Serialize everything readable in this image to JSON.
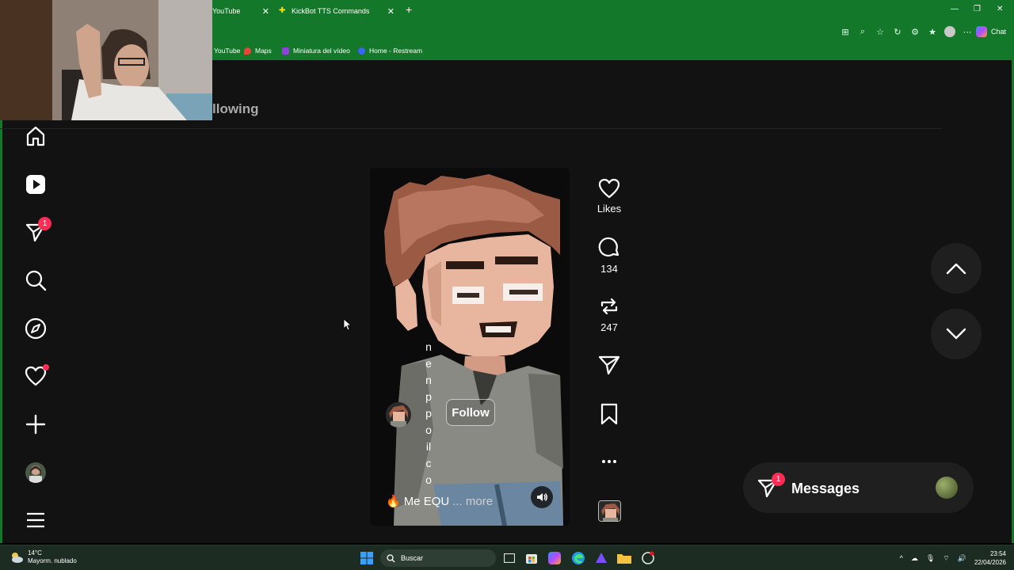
{
  "browser": {
    "tabs": [
      {
        "label": "YouTube"
      },
      {
        "label": "KickBot TTS Commands"
      }
    ],
    "new_tab": "+",
    "chat_label": "Chat",
    "bookmarks": [
      {
        "label": "YouTube"
      },
      {
        "label": "Maps"
      },
      {
        "label": "Miniatura del vídeo"
      },
      {
        "label": "Home - Restream"
      }
    ]
  },
  "page": {
    "heading_partial": "llowing"
  },
  "sidebar": {
    "notifications_badge": "1",
    "icons": [
      "home-icon",
      "reels-icon",
      "direct-icon",
      "search-icon",
      "explore-icon",
      "heart-icon",
      "create-icon",
      "profile-avatar",
      "menu-icon"
    ]
  },
  "reel": {
    "vertical_text": [
      "n",
      "e",
      "n",
      "p",
      "p",
      "o",
      "il",
      "c",
      "o"
    ],
    "follow_label": "Follow",
    "caption_emoji": "🔥",
    "caption": "Me EQU",
    "caption_more": "... more"
  },
  "actions": {
    "likes_label": "Likes",
    "comments_count": "134",
    "reposts_count": "247"
  },
  "messages": {
    "label": "Messages",
    "badge": "1"
  },
  "taskbar": {
    "weather_temp": "14°C",
    "weather_desc": "Mayorm. nublado",
    "search_placeholder": "Buscar",
    "time": "23:54",
    "date": "22/04/2026"
  },
  "colors": {
    "browser_green": "#14782a",
    "page_bg": "#121212",
    "badge_red": "#ff2d55",
    "hair": "#9a5a43",
    "skin": "#e8b59f",
    "shirt": "#8a8a84"
  }
}
